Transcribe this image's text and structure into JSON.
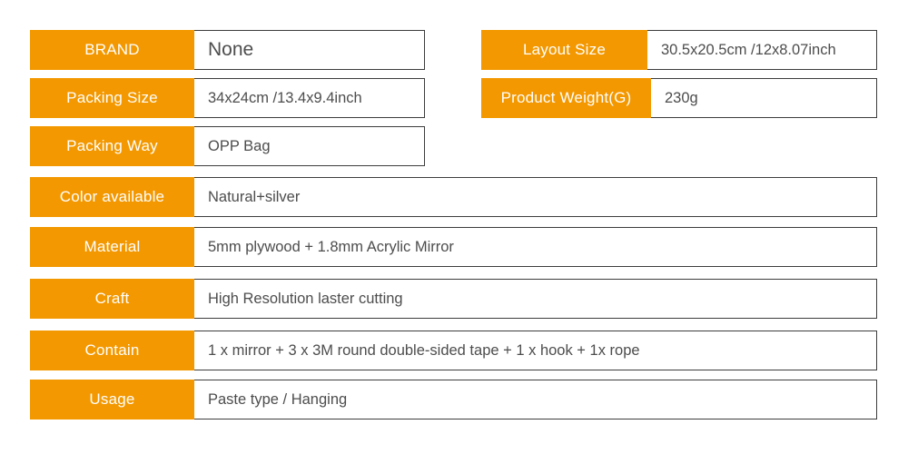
{
  "theme": {
    "accent_color": "#f39800",
    "label_text_color": "#ffffff",
    "value_text_color": "#4d4d4d",
    "border_color": "#3d3d3d",
    "background_color": "#ffffff"
  },
  "spec_table": {
    "left_column": [
      {
        "label": "BRAND",
        "value": "None"
      },
      {
        "label": "Packing Size",
        "value": "34x24cm /13.4x9.4inch"
      },
      {
        "label": "Packing Way",
        "value": "OPP Bag"
      },
      {
        "label": "Color available",
        "value": "Natural+silver"
      },
      {
        "label": "Material",
        "value": "5mm plywood + 1.8mm Acrylic Mirror"
      },
      {
        "label": "Craft",
        "value": "High Resolution laster cutting"
      },
      {
        "label": "Contain",
        "value": "1 x mirror + 3 x 3M round double-sided tape + 1 x hook + 1x rope"
      },
      {
        "label": "Usage",
        "value": "Paste type / Hanging"
      }
    ],
    "right_column": [
      {
        "label": "Layout Size",
        "value": "30.5x20.5cm /12x8.07inch"
      },
      {
        "label": "Product Weight(G)",
        "value": "230g"
      }
    ]
  }
}
